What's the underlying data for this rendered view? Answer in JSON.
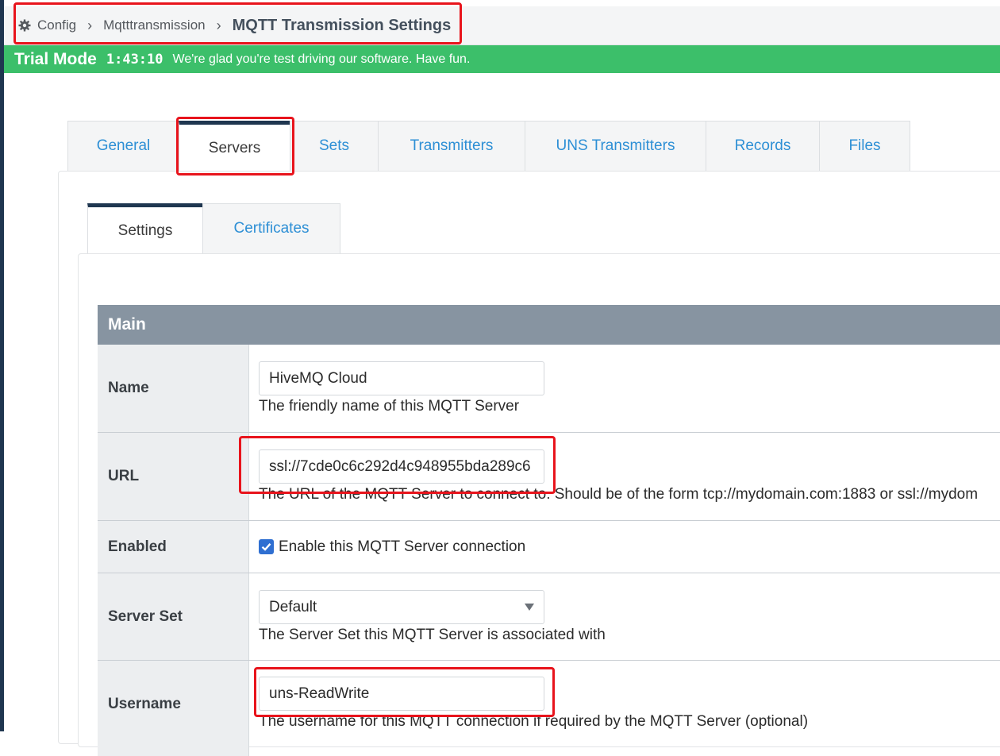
{
  "breadcrumb": {
    "items": [
      "Config",
      "Mqtttransmission"
    ],
    "current": "MQTT Transmission Settings"
  },
  "trial": {
    "mode": "Trial Mode",
    "time": "1:43:10",
    "message": "We're glad you're test driving our software. Have fun."
  },
  "tabs": {
    "general": "General",
    "servers": "Servers",
    "sets": "Sets",
    "transmitters": "Transmitters",
    "uns_transmitters": "UNS Transmitters",
    "records": "Records",
    "files": "Files",
    "active": "Servers"
  },
  "subtabs": {
    "settings": "Settings",
    "certificates": "Certificates",
    "active": "Settings"
  },
  "form": {
    "section": "Main",
    "name": {
      "label": "Name",
      "value": "HiveMQ Cloud",
      "help": "The friendly name of this MQTT Server"
    },
    "url": {
      "label": "URL",
      "value": "ssl://7cde0c6c292d4c948955bda289c6",
      "help": "The URL of the MQTT Server to connect to. Should be of the form tcp://mydomain.com:1883 or ssl://mydom"
    },
    "enabled": {
      "label": "Enabled",
      "checked": true,
      "text": "Enable this MQTT Server connection"
    },
    "server_set": {
      "label": "Server Set",
      "value": "Default",
      "help": "The Server Set this MQTT Server is associated with"
    },
    "username": {
      "label": "Username",
      "value": "uns-ReadWrite",
      "help": "The username for this MQTT connection if required by the MQTT Server (optional)"
    }
  },
  "colors": {
    "trial_banner": "#3cbf6a",
    "tab_link": "#2d8fd5",
    "active_tab_bar": "#1f3650",
    "section_header": "#8794a1",
    "highlight": "#e8141c",
    "checkbox": "#2f6fd1"
  }
}
